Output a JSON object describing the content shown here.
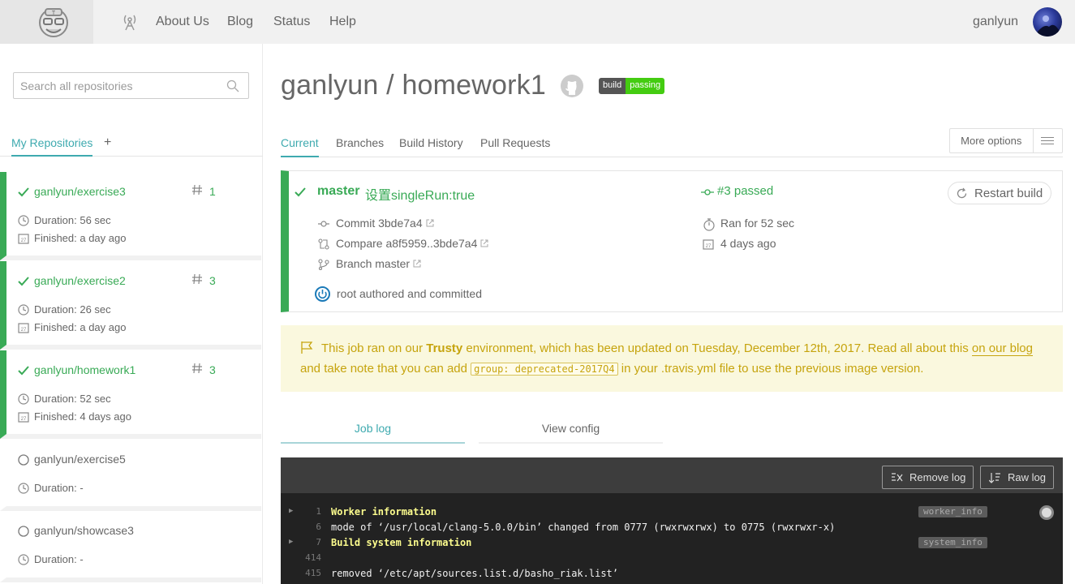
{
  "nav": {
    "links": [
      "About Us",
      "Blog",
      "Status",
      "Help"
    ],
    "user_name": "ganlyun"
  },
  "sidebar": {
    "search_placeholder": "Search all repositories",
    "tab_active": "My Repositories",
    "tab_add": "+",
    "repos": [
      {
        "name": "ganlyun/exercise3",
        "number": "1",
        "duration": "Duration: 56 sec",
        "finished": "Finished: a day ago",
        "status": "passed"
      },
      {
        "name": "ganlyun/exercise2",
        "number": "3",
        "duration": "Duration: 26 sec",
        "finished": "Finished: a day ago",
        "status": "passed"
      },
      {
        "name": "ganlyun/homework1",
        "number": "3",
        "duration": "Duration: 52 sec",
        "finished": "Finished: 4 days ago",
        "status": "passed"
      },
      {
        "name": "ganlyun/exercise5",
        "duration": "Duration: -",
        "status": "none"
      },
      {
        "name": "ganlyun/showcase3",
        "duration": "Duration: -",
        "status": "none"
      }
    ]
  },
  "main": {
    "title": "ganlyun / homework1",
    "badge": {
      "left": "build",
      "right": "passing"
    },
    "tabs": [
      "Current",
      "Branches",
      "Build History",
      "Pull Requests"
    ],
    "more_options": "More options",
    "build": {
      "branch": "master",
      "message": "设置singleRun:true",
      "number": "#3 passed",
      "restart": "Restart build",
      "commit": "Commit 3bde7a4",
      "compare": "Compare a8f5959..3bde7a4",
      "branch_link": "Branch master",
      "ran_for": "Ran for 52 sec",
      "date": "4 days ago",
      "author": "root authored and committed"
    },
    "notice": {
      "part1": "This job ran on our ",
      "trusty": "Trusty",
      "part2": " environment, which has been updated on Tuesday, December 12th, 2017. Read all about this ",
      "link": "on our blog",
      "part3": " and take note that you can add ",
      "code": "group: deprecated-2017Q4",
      "part4": " in your .travis.yml file to use the previous image version."
    },
    "log_tabs": [
      "Job log",
      "View config"
    ],
    "log_buttons": [
      "Remove log",
      "Raw log"
    ],
    "log_lines": [
      {
        "num": "1",
        "text": "Worker information",
        "bold": true,
        "tag": "worker_info",
        "fold": true
      },
      {
        "num": "6",
        "text": "mode of ‘/usr/local/clang-5.0.0/bin’ changed from 0777 (rwxrwxrwx) to 0775 (rwxrwxr-x)",
        "bold": false
      },
      {
        "num": "7",
        "text": "Build system information",
        "bold": true,
        "tag": "system_info",
        "fold": true
      },
      {
        "num": "414",
        "text": "",
        "bold": false
      },
      {
        "num": "415",
        "text": "removed ‘/etc/apt/sources.list.d/basho_riak.list’",
        "bold": false
      }
    ]
  },
  "colors": {
    "passed": "#39aa56",
    "teal": "#3eaaaf",
    "notice": "#c6a40e"
  }
}
